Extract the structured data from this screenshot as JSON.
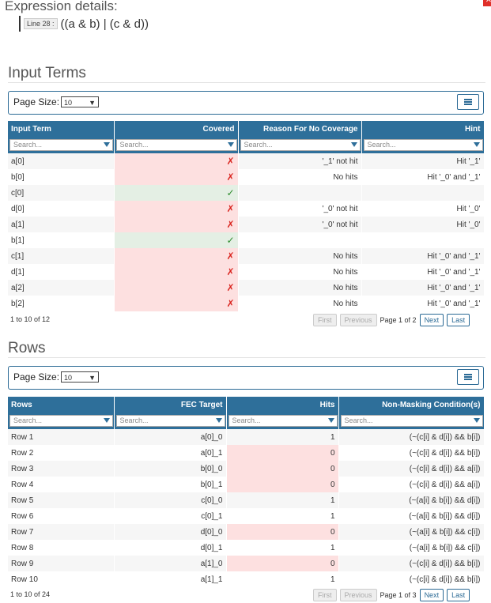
{
  "expression": {
    "title": "Expression details:",
    "line_badge": "Line 28 :",
    "text": "((a & b) | (c & d))"
  },
  "input_terms": {
    "section_title": "Input Terms",
    "page_size_label": "Page Size:",
    "page_size_value": "10",
    "columns": [
      "Input Term",
      "Covered",
      "Reason For No Coverage",
      "Hint"
    ],
    "filter_placeholder": "Search...",
    "rows": [
      {
        "term": "a[0]",
        "covered": false,
        "reason": "'_1' not hit",
        "hint": "Hit '_1'"
      },
      {
        "term": "b[0]",
        "covered": false,
        "reason": "No hits",
        "hint": "Hit '_0' and '_1'"
      },
      {
        "term": "c[0]",
        "covered": true,
        "reason": "",
        "hint": ""
      },
      {
        "term": "d[0]",
        "covered": false,
        "reason": "'_0' not hit",
        "hint": "Hit '_0'"
      },
      {
        "term": "a[1]",
        "covered": false,
        "reason": "'_0' not hit",
        "hint": "Hit '_0'"
      },
      {
        "term": "b[1]",
        "covered": true,
        "reason": "",
        "hint": ""
      },
      {
        "term": "c[1]",
        "covered": false,
        "reason": "No hits",
        "hint": "Hit '_0' and '_1'"
      },
      {
        "term": "d[1]",
        "covered": false,
        "reason": "No hits",
        "hint": "Hit '_0' and '_1'"
      },
      {
        "term": "a[2]",
        "covered": false,
        "reason": "No hits",
        "hint": "Hit '_0' and '_1'"
      },
      {
        "term": "b[2]",
        "covered": false,
        "reason": "No hits",
        "hint": "Hit '_0' and '_1'"
      }
    ],
    "count_text": "1 to 10 of 12",
    "pager": {
      "first": "First",
      "previous": "Previous",
      "info": "Page 1 of 2",
      "next": "Next",
      "last": "Last"
    }
  },
  "rows_section": {
    "section_title": "Rows",
    "page_size_label": "Page Size:",
    "page_size_value": "10",
    "columns": [
      "Rows",
      "FEC Target",
      "Hits",
      "Non-Masking Condition(s)"
    ],
    "filter_placeholder": "Search...",
    "rows": [
      {
        "row": "Row 1",
        "target": "a[0]_0",
        "hits": "1",
        "cond": "(~(c[i] & d[i]) && b[i])"
      },
      {
        "row": "Row 2",
        "target": "a[0]_1",
        "hits": "0",
        "cond": "(~(c[i] & d[i]) && b[i])"
      },
      {
        "row": "Row 3",
        "target": "b[0]_0",
        "hits": "0",
        "cond": "(~(c[i] & d[i]) && a[i])"
      },
      {
        "row": "Row 4",
        "target": "b[0]_1",
        "hits": "0",
        "cond": "(~(c[i] & d[i]) && a[i])"
      },
      {
        "row": "Row 5",
        "target": "c[0]_0",
        "hits": "1",
        "cond": "(~(a[i] & b[i]) && d[i])"
      },
      {
        "row": "Row 6",
        "target": "c[0]_1",
        "hits": "1",
        "cond": "(~(a[i] & b[i]) && d[i])"
      },
      {
        "row": "Row 7",
        "target": "d[0]_0",
        "hits": "0",
        "cond": "(~(a[i] & b[i]) && c[i])"
      },
      {
        "row": "Row 8",
        "target": "d[0]_1",
        "hits": "1",
        "cond": "(~(a[i] & b[i]) && c[i])"
      },
      {
        "row": "Row 9",
        "target": "a[1]_0",
        "hits": "0",
        "cond": "(~(c[i] & d[i]) && b[i])"
      },
      {
        "row": "Row 10",
        "target": "a[1]_1",
        "hits": "1",
        "cond": "(~(c[i] & d[i]) && b[i])"
      }
    ],
    "count_text": "1 to 10 of 24",
    "pager": {
      "first": "First",
      "previous": "Previous",
      "info": "Page 1 of 3",
      "next": "Next",
      "last": "Last"
    }
  },
  "icons": {
    "close": "close-icon",
    "menu": "menu-icon",
    "filter": "filter-icon",
    "cross": "cross-icon",
    "check": "check-icon",
    "dropdown": "caret-down-icon"
  },
  "colors": {
    "header": "#2e6f9a",
    "uncovered": "#fde0e0",
    "covered": "#e4efe4",
    "cross": "#d9231d",
    "check": "#2a8a2a"
  }
}
